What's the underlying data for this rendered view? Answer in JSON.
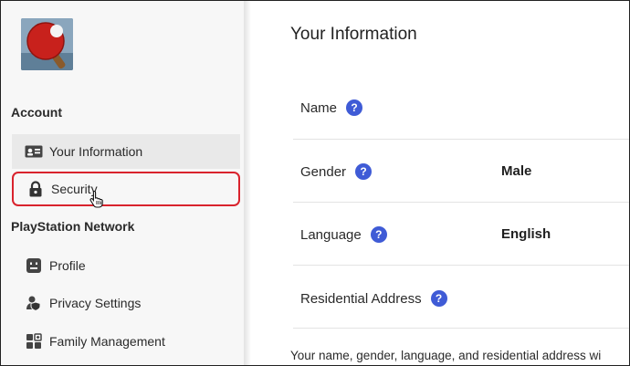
{
  "sidebar": {
    "account_heading": "Account",
    "account_items": [
      {
        "label": "Your Information",
        "icon": "id-card-icon"
      },
      {
        "label": "Security",
        "icon": "lock-icon"
      }
    ],
    "psn_heading": "PlayStation Network",
    "psn_items": [
      {
        "label": "Profile",
        "icon": "face-icon"
      },
      {
        "label": "Privacy Settings",
        "icon": "privacy-icon"
      },
      {
        "label": "Family Management",
        "icon": "family-icon"
      }
    ]
  },
  "main": {
    "title": "Your Information",
    "rows": [
      {
        "label": "Name",
        "value": ""
      },
      {
        "label": "Gender",
        "value": "Male"
      },
      {
        "label": "Language",
        "value": "English"
      },
      {
        "label": "Residential Address",
        "value": ""
      }
    ],
    "help_glyph": "?",
    "footer": "Your name, gender, language, and residential address wi"
  },
  "colors": {
    "accent_blue": "#3f5bd6",
    "highlight_red": "#d9232d",
    "sidebar_bg": "#f7f7f7"
  }
}
